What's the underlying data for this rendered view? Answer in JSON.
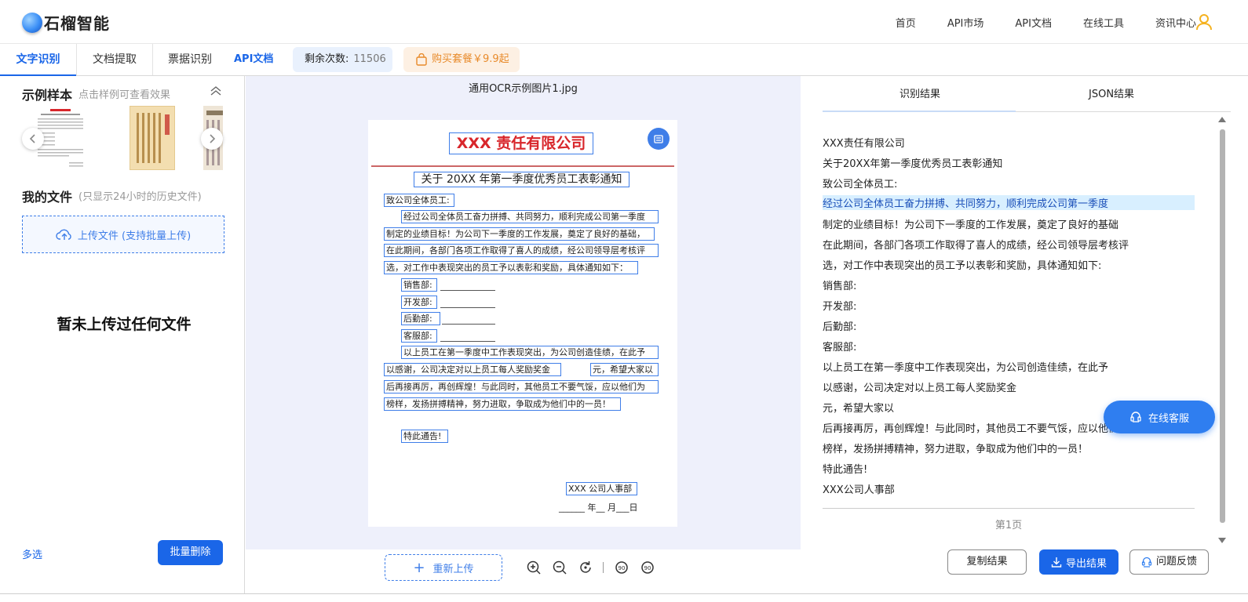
{
  "brand": {
    "name": "石榴智能"
  },
  "topnav": [
    "首页",
    "API市场",
    "API文档",
    "在线工具",
    "资讯中心"
  ],
  "tabs": [
    "文字识别",
    "文档提取",
    "票据识别"
  ],
  "api_doc_link": "API文档",
  "remaining": {
    "label": "剩余次数:",
    "value": "11506"
  },
  "buy_label": "购买套餐￥9.9起",
  "left": {
    "samples_title": "示例样本",
    "samples_hint": "点击样例可查看效果",
    "files_title": "我的文件",
    "files_hint": "(只显示24小时的历史文件)",
    "upload_label": "上传文件 (支持批量上传)",
    "empty_message": "暂未上传过任何文件",
    "multi_select": "多选",
    "batch_delete": "批量删除"
  },
  "center": {
    "file_name": "通用OCR示例图片1.jpg",
    "reupload": "重新上传",
    "doc": {
      "title": "XXX 责任有限公司",
      "subtitle": "关于 20XX 年第一季度优秀员工表彰通知",
      "lines": [
        "致公司全体员工:",
        "经过公司全体员工奋力拼搏、共同努力，顺利完成公司第一季度",
        "制定的业绩目标！为公司下一季度的工作发展，奠定了良好的基础，",
        "在此期间，各部门各项工作取得了喜人的成绩，经公司领导层考核评",
        "选，对工作中表现突出的员工予以表彰和奖励，具体通知如下：",
        "销售部:",
        "开发部:",
        "后勤部:",
        "客服部:",
        "以上员工在第一季度中工作表现突出，为公司创造佳绩，在此予",
        "以感谢，公司决定对以上员工每人奖励奖金",
        "元，希望大家以",
        "后再接再厉，再创辉煌！与此同时，其他员工不要气馁，应以他们为",
        "榜样，发扬拼搏精神，努力进取，争取成为他们中的一员！",
        "特此通告!",
        "XXX 公司人事部"
      ],
      "date_line": "______ 年__ 月___日"
    }
  },
  "right": {
    "tabs": [
      "识别结果",
      "JSON结果"
    ],
    "results": [
      "XXX责任有限公司",
      "关于20XX年第一季度优秀员工表彰通知",
      "致公司全体员工:",
      "经过公司全体员工奋力拼搏、共同努力，顺利完成公司第一季度",
      "制定的业绩目标！为公司下一季度的工作发展，奠定了良好的基础",
      "在此期间，各部门各项工作取得了喜人的成绩，经公司领导层考核评",
      "选，对工作中表现突出的员工予以表彰和奖励，具体通知如下:",
      "销售部:",
      "开发部:",
      "后勤部:",
      "客服部:",
      "以上员工在第一季度中工作表现突出，为公司创造佳绩，在此予",
      "以感谢，公司决定对以上员工每人奖励奖金",
      "元，希望大家以",
      "后再接再厉，再创辉煌！与此同时，其他员工不要气馁，应以他们",
      "榜样，发扬拼搏精神，努力进取，争取成为他们中的一员！",
      "特此通告!",
      "XXX公司人事部"
    ],
    "page_label": "第1页",
    "copy_btn": "复制结果",
    "export_btn": "导出结果",
    "feedback_btn": "问题反馈",
    "service_btn": "在线客服"
  },
  "colors": {
    "accent": "#1a66e8",
    "highlight": "#d8efff",
    "warn": "#e88a2a",
    "title_red": "#d8262b"
  }
}
